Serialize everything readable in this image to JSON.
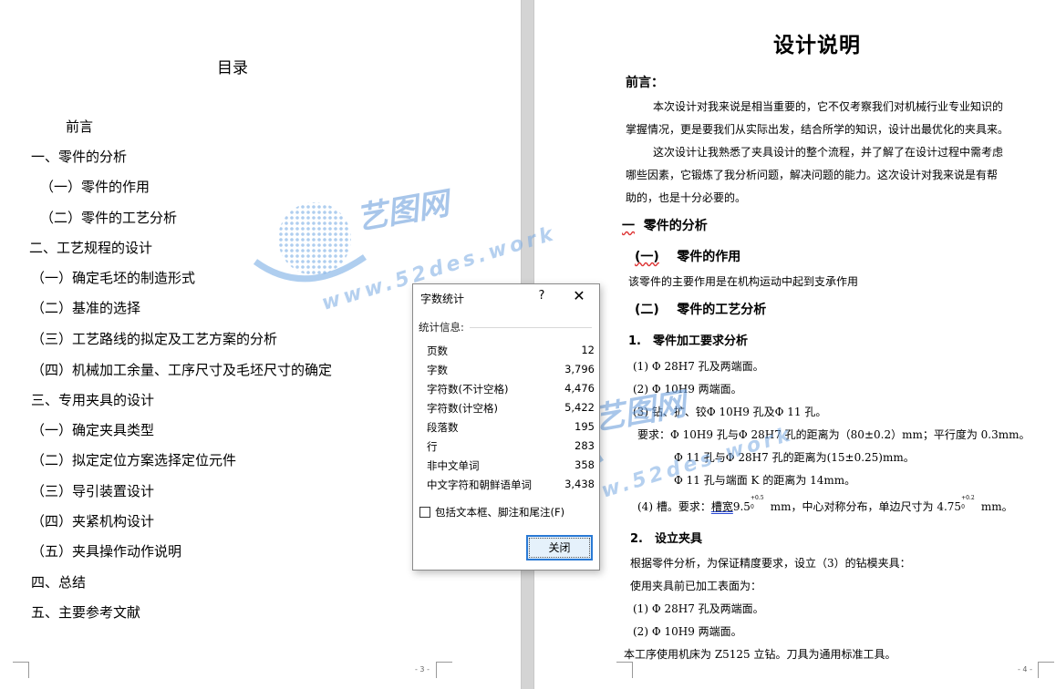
{
  "left_page": {
    "title": "目录",
    "toc": [
      "前言",
      "一、零件的分析",
      "（一）零件的作用",
      "（二）零件的工艺分析",
      "二、工艺规程的设计",
      "（一）确定毛坯的制造形式",
      "（二）基准的选择",
      "（三）工艺路线的拟定及工艺方案的分析",
      "（四）机械加工余量、工序尺寸及毛坯尺寸的确定",
      "三、专用夹具的设计",
      "（一）确定夹具类型",
      "（二）拟定定位方案选择定位元件",
      "（三）导引装置设计",
      "（四）夹紧机构设计",
      "（五）夹具操作动作说明",
      "四、总结",
      "五、主要参考文献"
    ],
    "page_number": "- 3 -"
  },
  "right_page": {
    "title": "设计说明",
    "preface_heading": "前言：",
    "preface_p1_l1": "本次设计对我来说是相当重要的，它不仅考察我们对机械行业专业知识的",
    "preface_p1_l2": "掌握情况，更是要我们从实际出发，结合所学的知识，设计出最优化的夹具来。",
    "preface_p2_l1": "这次设计让我熟悉了夹具设计的整个流程，并了解了在设计过程中需考虑",
    "preface_p2_l2": "哪些因素，它锻炼了我分析问题，解决问题的能力。这次设计对我来说是有帮",
    "preface_p2_l3": "助的，也是十分必要的。",
    "section1_num": "一",
    "section1_text": "零件的分析",
    "sub1_num": "(一)",
    "sub1_text": "零件的作用",
    "sub1_body": "该零件的主要作用是在机构运动中起到支承作用",
    "sub2_num": "(二)",
    "sub2_text": "零件的工艺分析",
    "item1_heading": "1.　零件加工要求分析",
    "req1": "(1)  Φ 28H7 孔及两端面。",
    "req2": "(2)  Φ 10H9 两端面。",
    "req3": "(3)  钻、扩、铰Φ 10H9 孔及Φ 11 孔。",
    "req_a": "要求：Φ 10H9 孔与Φ 28H7 孔的距离为（80±0.2）mm；平行度为 0.3mm。",
    "req_b": "Φ 11 孔与Φ 28H7 孔的距离为(15±0.25)mm。",
    "req_c": "Φ 11 孔与端面 K 的距离为 14mm。",
    "req4_prefix": "(4)  槽。要求：",
    "req4_groove": "槽宽",
    "req4_v1": "9.5",
    "req4_sup1": "+0.5",
    "req4_sub1": "0",
    "req4_mid": "mm，中心对称分布，单边尺寸为 4.75",
    "req4_sup2": "+0.2",
    "req4_sub2": "0",
    "req4_end": "mm。",
    "item2_heading": "2.　设立夹具",
    "fixture_l1": "根据零件分析，为保证精度要求，设立（3）的钻模夹具：",
    "fixture_l2": "使用夹具前已加工表面为：",
    "fixture_l3": "(1)  Φ 28H7 孔及两端面。",
    "fixture_l4": "(2)  Φ 10H9 两端面。",
    "fixture_l5": "本工序使用机床为 Z5125 立钻。刀具为通用标准工具。",
    "page_number": "- 4 -"
  },
  "watermark": {
    "brand": "艺图网",
    "url": "www.52des.work"
  },
  "dialog": {
    "title": "字数统计",
    "help": "?",
    "close": "✕",
    "section": "统计信息:",
    "stats": [
      {
        "label": "页数",
        "value": "12"
      },
      {
        "label": "字数",
        "value": "3,796"
      },
      {
        "label": "字符数(不计空格)",
        "value": "4,476"
      },
      {
        "label": "字符数(计空格)",
        "value": "5,422"
      },
      {
        "label": "段落数",
        "value": "195"
      },
      {
        "label": "行",
        "value": "283"
      },
      {
        "label": "非中文单词",
        "value": "358"
      },
      {
        "label": "中文字符和朝鲜语单词",
        "value": "3,438"
      }
    ],
    "checkbox_label": "包括文本框、脚注和尾注(F)",
    "close_button": "关闭"
  },
  "colors": {
    "accent": "#2a7ad5",
    "watermark": "#78aae1"
  }
}
